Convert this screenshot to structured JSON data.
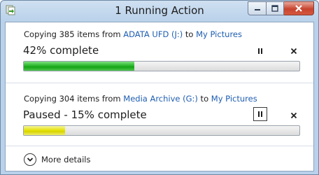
{
  "window": {
    "title": "1 Running Action",
    "controls": {
      "minimize": "minimize",
      "maximize": "maximize",
      "close": "close"
    }
  },
  "operations": [
    {
      "prefix": "Copying 385 items from ",
      "source": "ADATA UFD (J:)",
      "middle": " to ",
      "destination": "My Pictures",
      "status": "42% complete",
      "progress": 0.4,
      "progress_color": "#21b121",
      "state": "running",
      "pause_icon": "pause-icon",
      "cancel_icon": "close-icon"
    },
    {
      "prefix": "Copying 304 items from ",
      "source": "Media Archive (G:)",
      "middle": " to ",
      "destination": "My Pictures",
      "status": "Paused - 15% complete",
      "progress": 0.15,
      "progress_color": "#e2e000",
      "state": "paused",
      "pause_icon": "pause-icon",
      "cancel_icon": "close-icon"
    }
  ],
  "footer": {
    "details_label": "More details",
    "details_icon": "chevron-down-icon"
  },
  "colors": {
    "link": "#1e5db1",
    "window_frame": "#b9d1ea"
  }
}
